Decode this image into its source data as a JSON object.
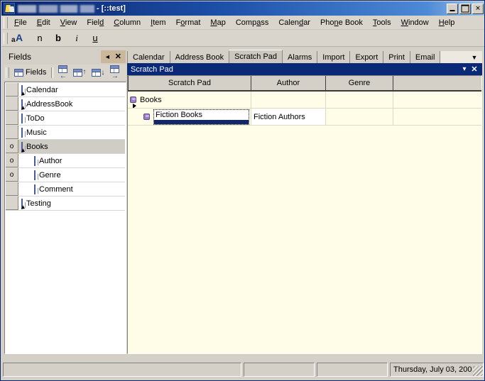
{
  "window": {
    "title_suffix": "- [::test]",
    "app_name_redacted": true,
    "buttons": {
      "minimize": "_",
      "maximize": "□",
      "close": "✕"
    }
  },
  "menubar": {
    "items": [
      {
        "label": "File",
        "mnemonic": "F"
      },
      {
        "label": "Edit",
        "mnemonic": "E"
      },
      {
        "label": "View",
        "mnemonic": "V"
      },
      {
        "label": "Field",
        "mnemonic": "d"
      },
      {
        "label": "Column",
        "mnemonic": "C"
      },
      {
        "label": "Item",
        "mnemonic": "I"
      },
      {
        "label": "Format",
        "mnemonic": "o"
      },
      {
        "label": "Map",
        "mnemonic": "M"
      },
      {
        "label": "Compass",
        "mnemonic": "a"
      },
      {
        "label": "Calendar",
        "mnemonic": "d"
      },
      {
        "label": "Phone Book",
        "mnemonic": "n"
      },
      {
        "label": "Tools",
        "mnemonic": "T"
      },
      {
        "label": "Window",
        "mnemonic": "W"
      },
      {
        "label": "Help",
        "mnemonic": "H"
      }
    ]
  },
  "format_toolbar": {
    "buttons": [
      {
        "name": "font-button",
        "label": "aA"
      },
      {
        "name": "normal-button",
        "label": "n"
      },
      {
        "name": "bold-button",
        "label": "b"
      },
      {
        "name": "italic-button",
        "label": "i"
      },
      {
        "name": "underline-button",
        "label": "u"
      }
    ]
  },
  "fields_panel": {
    "caption": "Fields",
    "collapse_glyph": "◄",
    "close_glyph": "✕",
    "toolbar": {
      "label": "Fields",
      "move_left_glyph": "←",
      "move_up_glyph": "↑",
      "move_down_glyph": "↓",
      "move_right_glyph": "→"
    },
    "tree": [
      {
        "label": "Calendar",
        "level": 0,
        "marker": "",
        "selected": false,
        "has_cursor": true
      },
      {
        "label": "AddressBook",
        "level": 0,
        "marker": "",
        "selected": false,
        "has_cursor": true
      },
      {
        "label": "ToDo",
        "level": 0,
        "marker": "",
        "selected": false,
        "has_cursor": false
      },
      {
        "label": "Music",
        "level": 0,
        "marker": "",
        "selected": false,
        "has_cursor": false
      },
      {
        "label": "Books",
        "level": 0,
        "marker": "o",
        "selected": true,
        "has_cursor": true
      },
      {
        "label": "Author",
        "level": 1,
        "marker": "o",
        "selected": false,
        "has_cursor": false
      },
      {
        "label": "Genre",
        "level": 1,
        "marker": "o",
        "selected": false,
        "has_cursor": false
      },
      {
        "label": "Comment",
        "level": 1,
        "marker": "",
        "selected": false,
        "has_cursor": false
      },
      {
        "label": "Testing",
        "level": 0,
        "marker": "",
        "selected": false,
        "has_cursor": true
      }
    ]
  },
  "mdi": {
    "tabs": [
      {
        "label": "Calendar",
        "active": false
      },
      {
        "label": "Address Book",
        "active": false
      },
      {
        "label": "Scratch Pad",
        "active": true
      },
      {
        "label": "Alarms",
        "active": false
      },
      {
        "label": "Import",
        "active": false
      },
      {
        "label": "Export",
        "active": false
      },
      {
        "label": "Print",
        "active": false
      },
      {
        "label": "Email",
        "active": false
      }
    ],
    "tab_dropdown_glyph": "▼",
    "caption": {
      "title": "Scratch Pad",
      "menu_glyph": "▾",
      "close_glyph": "✕"
    },
    "grid": {
      "columns": [
        "Scratch Pad",
        "Author",
        "Genre",
        ""
      ],
      "rows": [
        {
          "level": 0,
          "expanded": true,
          "editing": false,
          "cells": [
            "Books",
            "",
            "",
            ""
          ]
        },
        {
          "level": 1,
          "expanded": true,
          "editing": true,
          "cells": [
            "Fiction Books",
            "Fiction Authors",
            "",
            ""
          ]
        }
      ]
    }
  },
  "statusbar": {
    "panel1": "",
    "panel2": "",
    "panel3": "",
    "date": "Thursday, July 03, 200"
  }
}
